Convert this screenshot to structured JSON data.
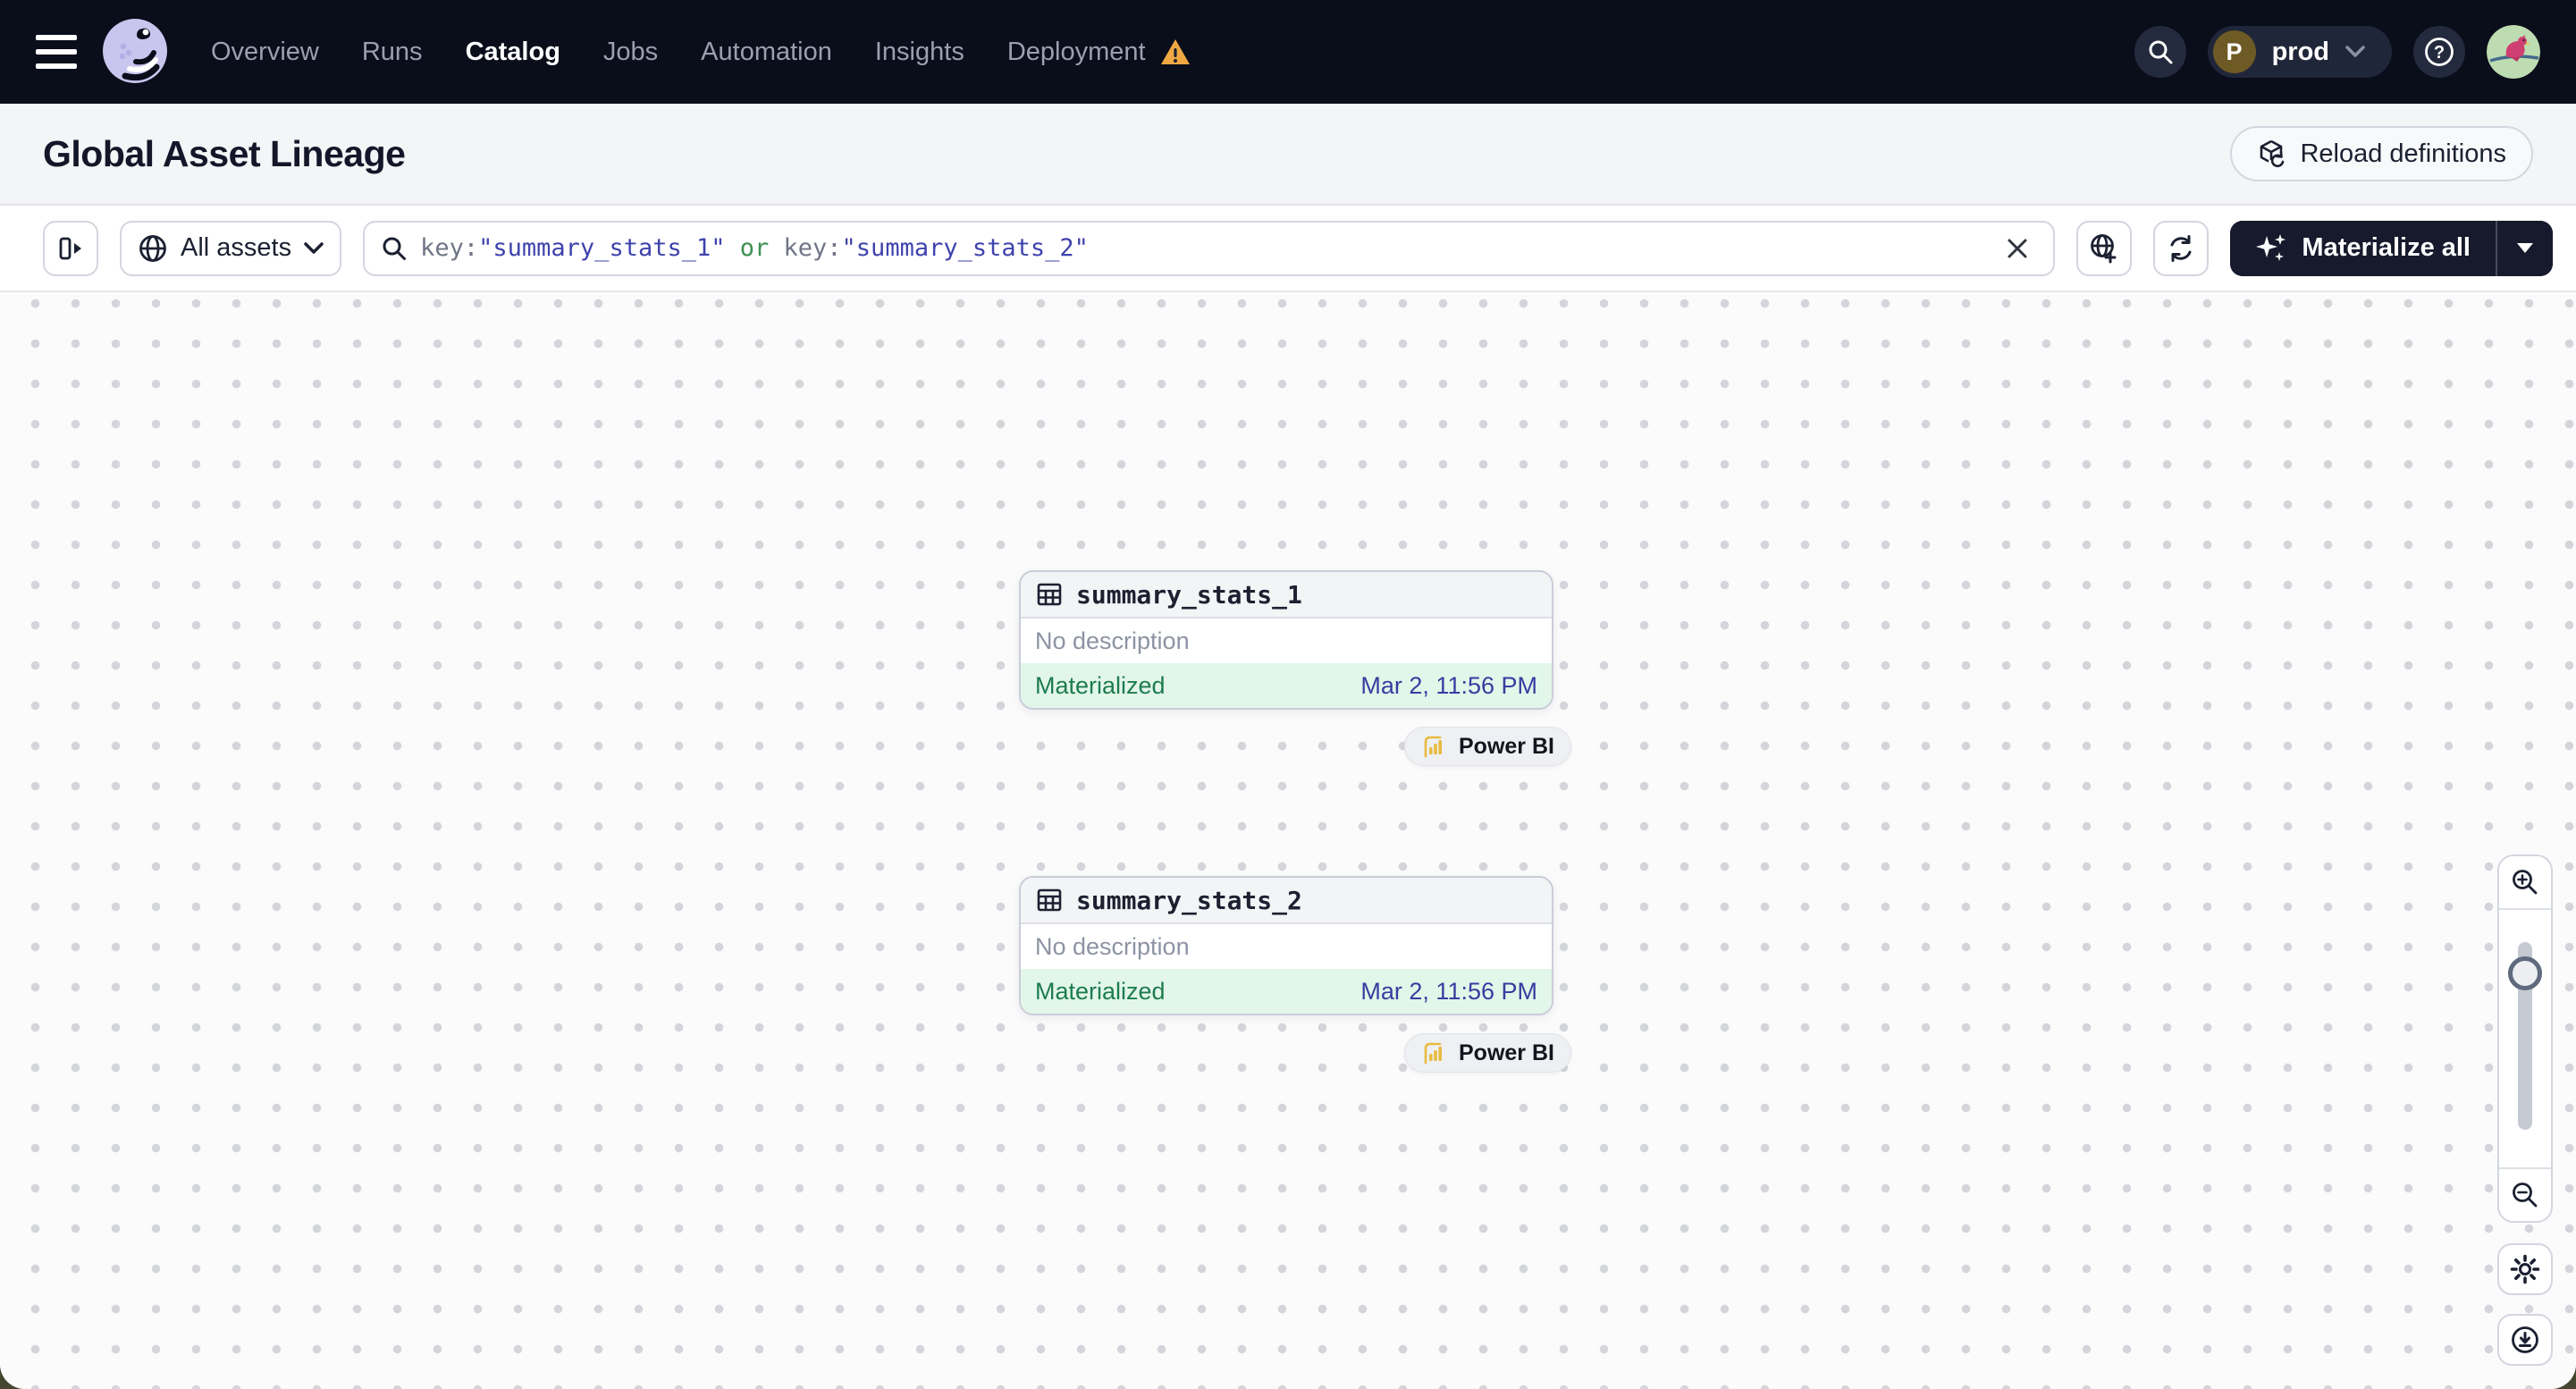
{
  "nav": {
    "items": [
      {
        "label": "Overview"
      },
      {
        "label": "Runs"
      },
      {
        "label": "Catalog"
      },
      {
        "label": "Jobs"
      },
      {
        "label": "Automation"
      },
      {
        "label": "Insights"
      },
      {
        "label": "Deployment"
      }
    ],
    "active_item": "Catalog",
    "deployment_has_warning": true,
    "environment": {
      "initial": "P",
      "name": "prod"
    }
  },
  "page": {
    "title": "Global Asset Lineage",
    "reload_button_label": "Reload definitions"
  },
  "toolbar": {
    "scope_selector_label": "All assets",
    "materialize_button_label": "Materialize all",
    "query": {
      "segments": [
        {
          "text": "key:",
          "kind": "field"
        },
        {
          "text": "\"summary_stats_1\"",
          "kind": "value"
        },
        {
          "text": " or ",
          "kind": "operator"
        },
        {
          "text": "key:",
          "kind": "field"
        },
        {
          "text": "\"summary_stats_2\"",
          "kind": "value"
        }
      ]
    }
  },
  "lineage": {
    "nodes": [
      {
        "name": "summary_stats_1",
        "description": "No description",
        "status": "Materialized",
        "materialized_at": "Mar 2, 11:56 PM",
        "tag": "Power BI"
      },
      {
        "name": "summary_stats_2",
        "description": "No description",
        "status": "Materialized",
        "materialized_at": "Mar 2, 11:56 PM",
        "tag": "Power BI"
      }
    ]
  },
  "colors": {
    "nav_background": "#0a0d1a",
    "accent_dark_button": "#161a2c",
    "status_materialized_text": "#1d7c4f",
    "status_materialized_background": "#e2f6e9",
    "timestamp_text": "#393ca0",
    "query_value_text": "#3f43ad",
    "query_operator_text": "#3e8f52",
    "warning_orange": "#f0a843",
    "powerbi_yellow": "#e8bb3f",
    "logo_lavender": "#c9c5ee"
  }
}
